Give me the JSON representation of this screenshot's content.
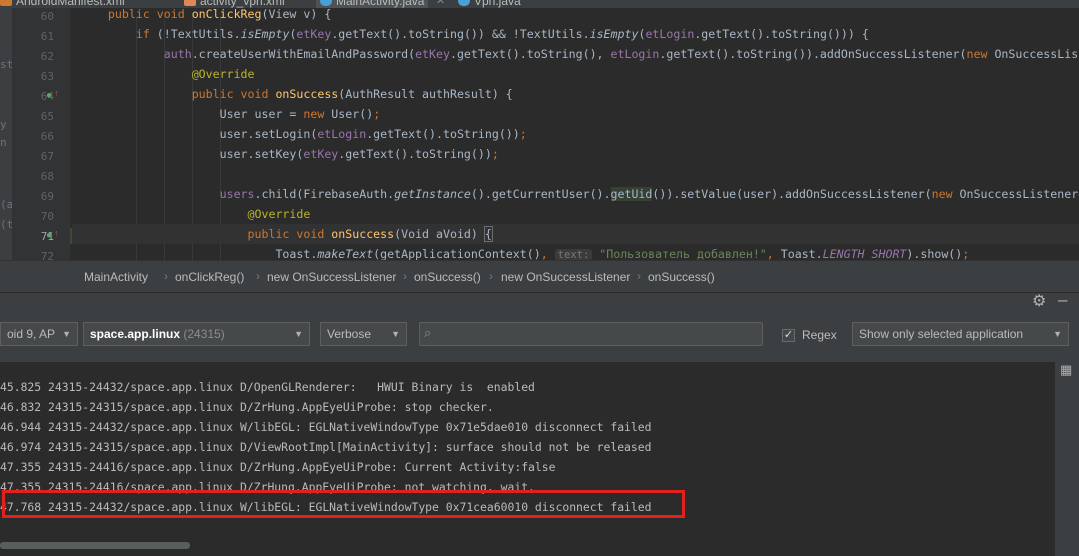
{
  "tabs": [
    {
      "label": "AndroidManifest.xml",
      "icon_color": "#cc7832",
      "active": false
    },
    {
      "label": "activity_vpn.xml",
      "icon_color": "#e08855",
      "active": false
    },
    {
      "label": "MainActivity.java",
      "icon_color": "#4a9fd6",
      "active": true
    },
    {
      "label": "Vpn.java",
      "icon_color": "#4a9fd6",
      "active": false
    }
  ],
  "left_strip_fragments": [
    "st",
    "y",
    "n",
    "(a",
    "(t"
  ],
  "editor": {
    "line_numbers": [
      "60",
      "61",
      "62",
      "63",
      "64",
      "65",
      "66",
      "67",
      "68",
      "69",
      "70",
      "71",
      "72"
    ],
    "current_line": "71",
    "lines": [
      "    public void onClickReg(View v) {",
      "        if (!TextUtils.isEmpty(etKey.getText().toString()) && !TextUtils.isEmpty(etLogin.getText().toString())) {",
      "            auth.createUserWithEmailAndPassword(etKey.getText().toString(), etLogin.getText().toString()).addOnSuccessListener(new OnSuccessListener<AuthResult>() {",
      "                @Override",
      "                public void onSuccess(AuthResult authResult) {",
      "                    User user = new User();",
      "                    user.setLogin(etLogin.getText().toString());",
      "                    user.setKey(etKey.getText().toString());",
      "",
      "                    users.child(FirebaseAuth.getInstance().getCurrentUser().getUid()).setValue(user).addOnSuccessListener(new OnSuccessListener<Void>() {",
      "                        @Override",
      "                        public void onSuccess(Void aVoid) {",
      "                            Toast.makeText(getApplicationContext(), text: \"Пользователь добавлен!\", Toast.LENGTH_SHORT).show();"
    ],
    "hint_label": "text:",
    "toast_message": "\"Пользователь добавлен!\""
  },
  "breadcrumbs": [
    "MainActivity",
    "onClickReg()",
    "new OnSuccessListener",
    "onSuccess()",
    "new OnSuccessListener",
    "onSuccess()"
  ],
  "logcat": {
    "device": "oid 9, AP",
    "process_name": "space.app.linux",
    "process_pid": "(24315)",
    "log_level": "Verbose",
    "search_placeholder": "",
    "regex_label": "Regex",
    "regex_checked": true,
    "filter_mode": "Show only selected application",
    "lines": [
      "45.825 24315-24432/space.app.linux D/OpenGLRenderer:   HWUI Binary is  enabled",
      "46.832 24315-24315/space.app.linux D/ZrHung.AppEyeUiProbe: stop checker.",
      "46.944 24315-24432/space.app.linux W/libEGL: EGLNativeWindowType 0x71e5dae010 disconnect failed",
      "46.974 24315-24315/space.app.linux D/ViewRootImpl[MainActivity]: surface should not be released",
      "47.355 24315-24416/space.app.linux D/ZrHung.AppEyeUiProbe: Current Activity:false",
      "47.355 24315-24416/space.app.linux D/ZrHung.AppEyeUiProbe: not watching, wait.",
      "47.768 24315-24432/space.app.linux W/libEGL: EGLNativeWindowType 0x71cea60010 disconnect failed"
    ],
    "highlighted_line_index": 6,
    "highlight_color": "#e3201b"
  },
  "icons": [
    "settings-gear-icon",
    "hide-minus-icon",
    "search-icon",
    "dropdown-arrow-icon",
    "layout-icon",
    "checkmark-icon",
    "override-marker-icon"
  ]
}
